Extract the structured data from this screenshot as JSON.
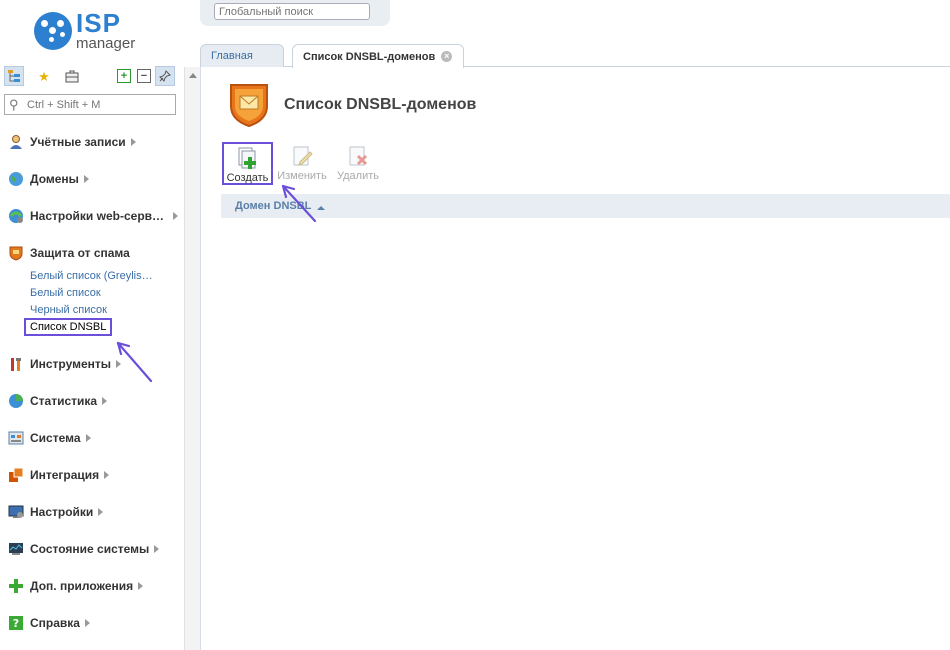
{
  "logo": {
    "brand": "ISP",
    "product": "manager"
  },
  "topbar": {
    "search_placeholder": "Глобальный поиск"
  },
  "tabs": [
    {
      "label": "Главная",
      "active": false
    },
    {
      "label": "Список DNSBL-доменов",
      "active": true
    }
  ],
  "sidebar": {
    "search_placeholder": "Ctrl + Shift + M",
    "toolbar_icons": [
      "tree-view-icon",
      "favorites-star-icon",
      "briefcase-icon",
      "expand-all-icon",
      "collapse-all-icon",
      "pin-icon"
    ],
    "items": [
      {
        "label": "Учётные записи",
        "icon": "users-icon"
      },
      {
        "label": "Домены",
        "icon": "globe-icon"
      },
      {
        "label": "Настройки web-серв…",
        "icon": "web-settings-icon"
      },
      {
        "label": "Защита от спама",
        "icon": "spam-shield-icon"
      },
      {
        "label": "Инструменты",
        "icon": "tools-icon"
      },
      {
        "label": "Статистика",
        "icon": "pie-chart-icon"
      },
      {
        "label": "Система",
        "icon": "system-icon"
      },
      {
        "label": "Интеграция",
        "icon": "integration-icon"
      },
      {
        "label": "Настройки",
        "icon": "settings-monitor-icon"
      },
      {
        "label": "Состояние системы",
        "icon": "system-status-icon"
      },
      {
        "label": "Доп. приложения",
        "icon": "plus-icon"
      },
      {
        "label": "Справка",
        "icon": "help-icon"
      }
    ],
    "spam_subitems": [
      {
        "label": "Белый список (Greylis…",
        "selected": false
      },
      {
        "label": "Белый список",
        "selected": false
      },
      {
        "label": "Черный список",
        "selected": false
      },
      {
        "label": "Список DNSBL",
        "selected": true
      }
    ]
  },
  "main": {
    "title": "Список DNSBL-доменов",
    "actions": [
      {
        "label": "Создать",
        "enabled": true
      },
      {
        "label": "Изменить",
        "enabled": false
      },
      {
        "label": "Удалить",
        "enabled": false
      }
    ],
    "columns": [
      {
        "label": "Домен DNSBL",
        "sort": "ascending"
      }
    ]
  },
  "colors": {
    "highlight": "#6b4fd8",
    "brand_blue": "#2d7fd0",
    "header_bg": "#e8edf3"
  }
}
